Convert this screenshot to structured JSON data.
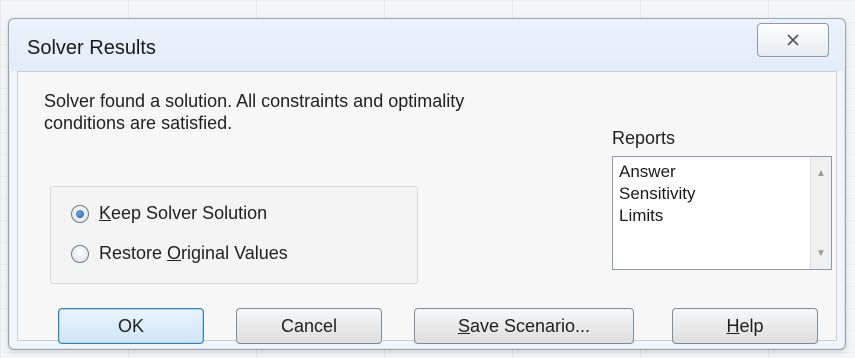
{
  "dialog": {
    "title": "Solver Results",
    "close_label": "☒"
  },
  "message": {
    "line1": "Solver found a solution.  All constraints and optimality",
    "line2": "conditions are satisfied."
  },
  "options": [
    {
      "label_prefix": "",
      "mnemonic": "K",
      "label_rest": "eep Solver Solution",
      "checked": true
    },
    {
      "label_prefix": "Restore ",
      "mnemonic": "O",
      "label_rest": "riginal Values",
      "checked": false
    }
  ],
  "reports": {
    "label": "Reports",
    "items": [
      "Answer",
      "Sensitivity",
      "Limits"
    ],
    "scroll_up": "▲",
    "scroll_down": "▼"
  },
  "buttons": {
    "ok": "OK",
    "cancel": "Cancel",
    "save_prefix": "",
    "save_mnemonic": "S",
    "save_rest": "ave Scenario...",
    "help_prefix": "",
    "help_mnemonic": "H",
    "help_rest": "elp"
  }
}
